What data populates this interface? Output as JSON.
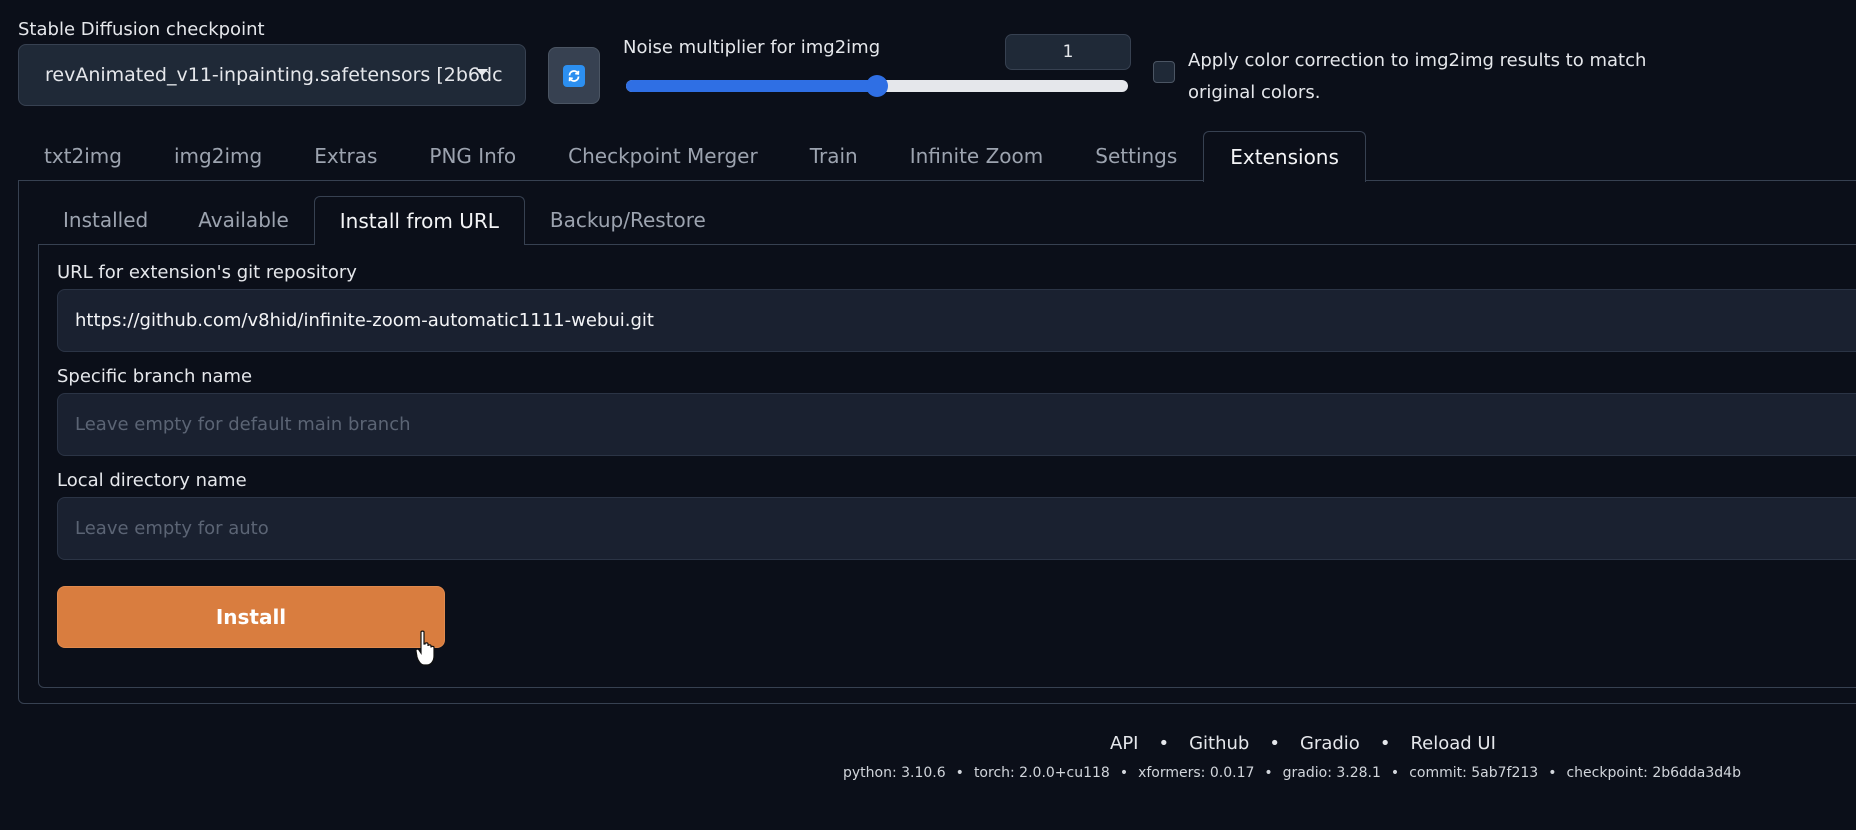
{
  "top": {
    "checkpoint_label": "Stable Diffusion checkpoint",
    "checkpoint_value": "revAnimated_v11-inpainting.safetensors [2b6dc",
    "refresh_icon": "refresh-icon",
    "noise_label": "Noise multiplier for img2img",
    "noise_value": "1",
    "noise_slider_fraction": 0.5,
    "color_correction_label": "Apply color correction to img2img results to match original colors.",
    "color_correction_checked": false
  },
  "main_tabs": [
    {
      "label": "txt2img",
      "active": false
    },
    {
      "label": "img2img",
      "active": false
    },
    {
      "label": "Extras",
      "active": false
    },
    {
      "label": "PNG Info",
      "active": false
    },
    {
      "label": "Checkpoint Merger",
      "active": false
    },
    {
      "label": "Train",
      "active": false
    },
    {
      "label": "Infinite Zoom",
      "active": false
    },
    {
      "label": "Settings",
      "active": false
    },
    {
      "label": "Extensions",
      "active": true
    }
  ],
  "sub_tabs": [
    {
      "label": "Installed",
      "active": false
    },
    {
      "label": "Available",
      "active": false
    },
    {
      "label": "Install from URL",
      "active": true
    },
    {
      "label": "Backup/Restore",
      "active": false
    }
  ],
  "form": {
    "url_label": "URL for extension's git repository",
    "url_value": "https://github.com/v8hid/infinite-zoom-automatic1111-webui.git",
    "branch_label": "Specific branch name",
    "branch_placeholder": "Leave empty for default main branch",
    "dir_label": "Local directory name",
    "dir_placeholder": "Leave empty for auto",
    "install_label": "Install"
  },
  "footer": {
    "links": [
      "API",
      "Github",
      "Gradio",
      "Reload UI"
    ],
    "separator": "•",
    "versions": [
      "python: 3.10.6",
      "torch: 2.0.0+cu118",
      "xformers: 0.0.17",
      "gradio: 3.28.1",
      "commit: 5ab7f213",
      "checkpoint: 2b6dda3d4b"
    ]
  },
  "colors": {
    "background": "#0b0f19",
    "input_bg": "#1a2130",
    "accent_blue": "#2f6fe4",
    "install_orange": "#d97d3f"
  }
}
